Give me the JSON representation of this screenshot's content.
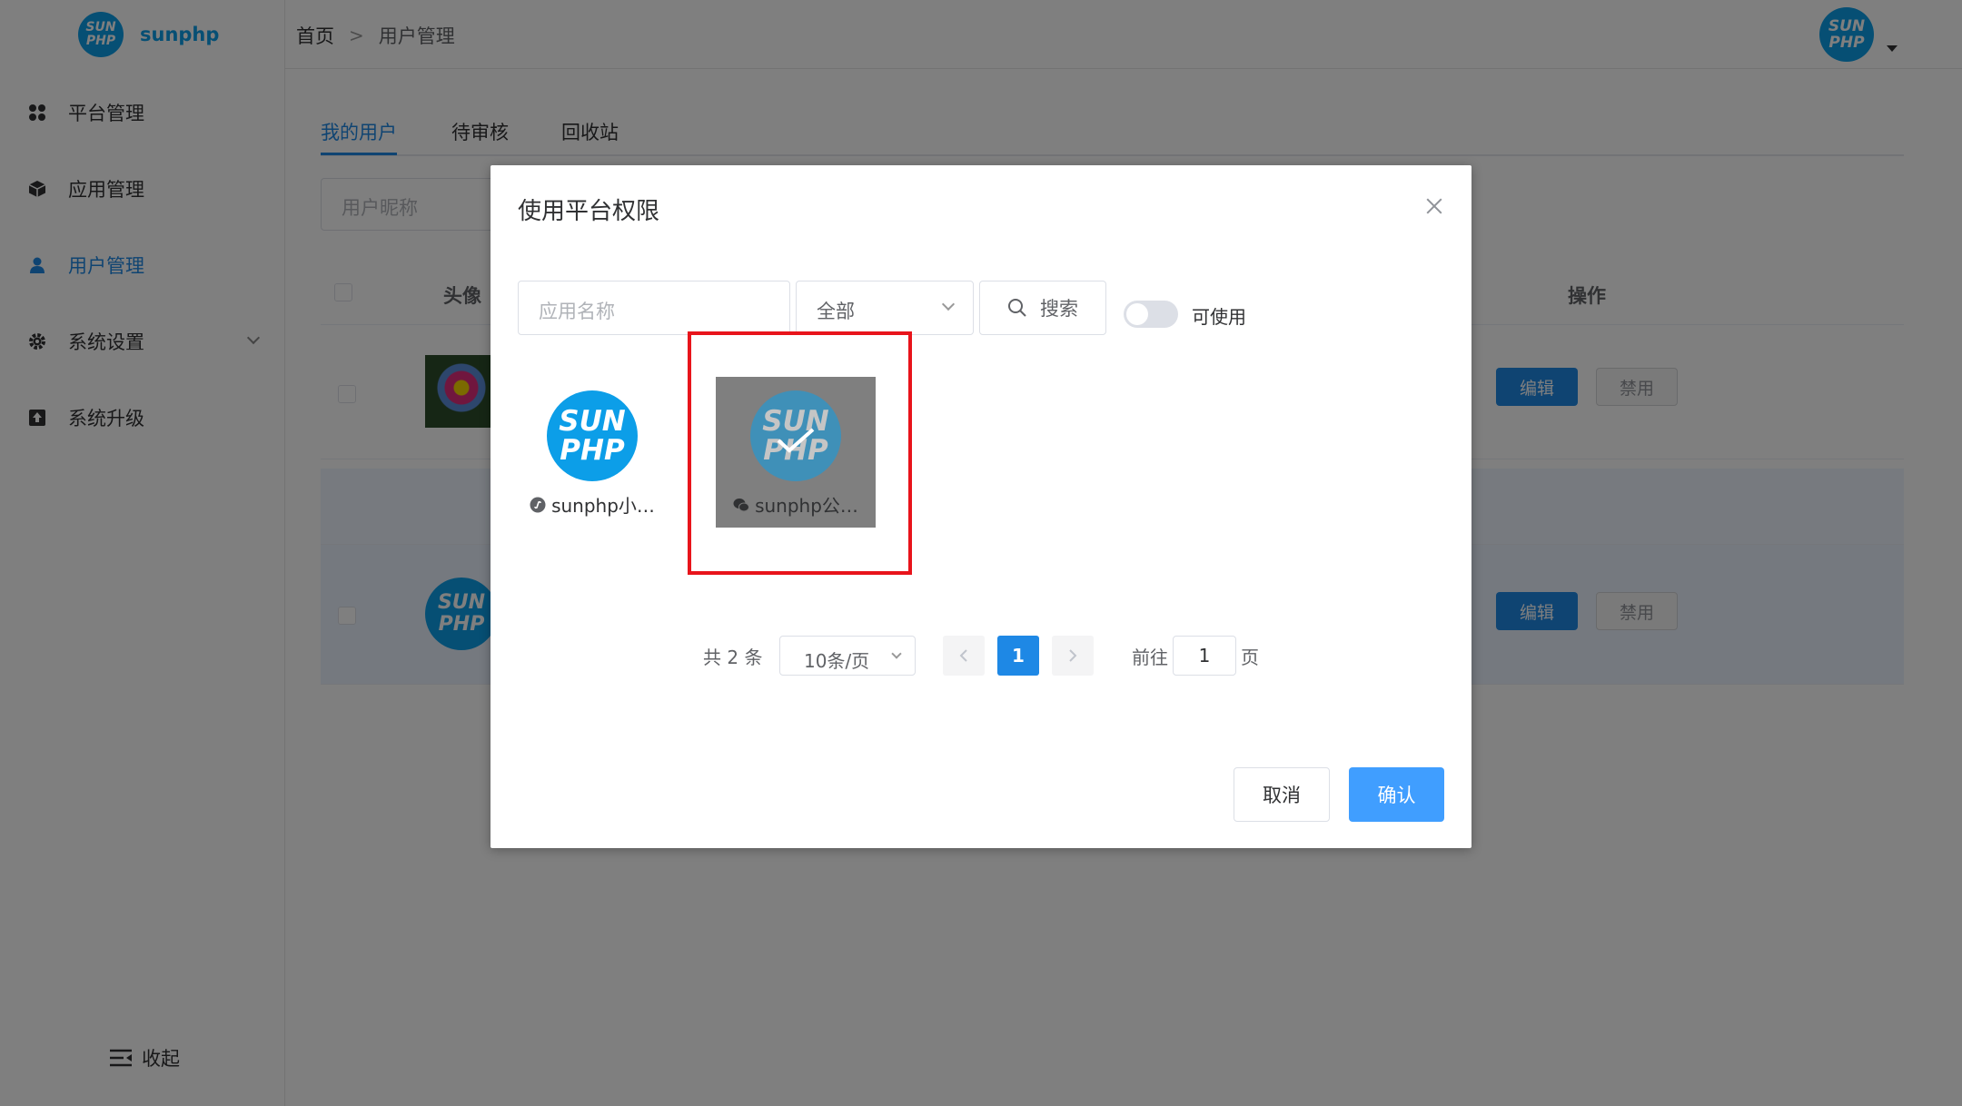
{
  "brand": {
    "logo_text": "SUN PHP",
    "name": "sunphp"
  },
  "sidebar": {
    "items": [
      {
        "label": "平台管理",
        "icon": "grid-icon"
      },
      {
        "label": "应用管理",
        "icon": "cube-icon"
      },
      {
        "label": "用户管理",
        "icon": "user-icon",
        "active": true
      },
      {
        "label": "系统设置",
        "icon": "gear-icon",
        "expandable": true
      },
      {
        "label": "系统升级",
        "icon": "upload-icon"
      }
    ],
    "collapse_label": "收起"
  },
  "header": {
    "breadcrumb": {
      "home": "首页",
      "separator": ">",
      "current": "用户管理"
    },
    "avatar_text": "SUN PHP"
  },
  "main": {
    "tabs": [
      "我的用户",
      "待审核",
      "回收站"
    ],
    "active_tab": 0,
    "filter_placeholder": "用户昵称",
    "table": {
      "headers": {
        "avatar": "头像",
        "actions": "操作"
      },
      "rows": [
        {
          "avatar_type": "flower-image",
          "edit": "编辑",
          "disable": "禁用"
        },
        {
          "avatar_type": "sunphp-logo",
          "avatar_text": "SUN PHP",
          "edit": "编辑",
          "disable": "禁用"
        }
      ]
    }
  },
  "dialog": {
    "title": "使用平台权限",
    "search_placeholder": "应用名称",
    "select_value": "全部",
    "search_label": "搜索",
    "toggle_label": "可使用",
    "toggle_on": false,
    "apps": [
      {
        "logo_text": "SUN PHP",
        "name": "sunphp小…",
        "type_icon": "mini-program-icon",
        "selected": false
      },
      {
        "logo_text": "SUN PHP",
        "name": "sunphp公…",
        "type_icon": "wechat-icon",
        "selected": true
      }
    ],
    "pagination": {
      "total": "共 2 条",
      "page_size": "10条/页",
      "current_page": "1",
      "goto_label": "前往",
      "goto_value": "1",
      "page_label": "页"
    },
    "cancel_label": "取消",
    "confirm_label": "确认"
  },
  "colors": {
    "primary": "#1e88e5",
    "brand": "#0c9ee8",
    "highlight": "#e8141b",
    "confirm": "#409eff"
  }
}
